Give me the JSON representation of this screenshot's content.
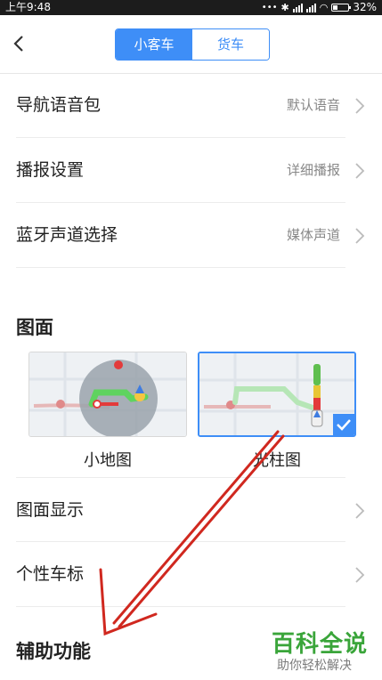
{
  "status": {
    "time": "上午9:48",
    "battery": "32%"
  },
  "header": {
    "tabs": [
      "小客车",
      "货车"
    ],
    "active_tab": 0
  },
  "settings": [
    {
      "label": "导航语音包",
      "value": "默认语音"
    },
    {
      "label": "播报设置",
      "value": "详细播报"
    },
    {
      "label": "蓝牙声道选择",
      "value": "媒体声道"
    }
  ],
  "map_section": {
    "title": "图面",
    "options": [
      {
        "label": "小地图",
        "selected": false
      },
      {
        "label": "光柱图",
        "selected": true
      }
    ]
  },
  "display_rows": [
    {
      "label": "图面显示"
    },
    {
      "label": "个性车标"
    }
  ],
  "assist": {
    "title": "辅助功能"
  },
  "watermark": {
    "title": "百科全说",
    "subtitle": "助你轻松解决"
  },
  "colors": {
    "accent": "#3e8ef7",
    "annotation_arrow": "#d0281f",
    "watermark": "#3aa53a"
  }
}
